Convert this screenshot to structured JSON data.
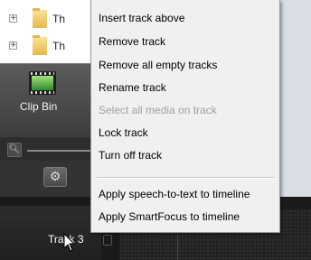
{
  "tree": {
    "items": [
      {
        "label": "Th",
        "expander": "+"
      },
      {
        "label": "Th",
        "expander": "+"
      }
    ]
  },
  "clip_bin": {
    "label": "Clip Bin"
  },
  "zoom": {
    "icon": "magnifier-icon"
  },
  "gear": {
    "icon": "gear-icon"
  },
  "track": {
    "label": "Track 3"
  },
  "context_menu": {
    "insert_track_above": "Insert track above",
    "remove_track": "Remove track",
    "remove_all_empty_tracks": "Remove all empty tracks",
    "rename_track": "Rename track",
    "select_all_media_on_track": "Select all media on track",
    "lock_track": "Lock track",
    "turn_off_track": "Turn off track",
    "apply_speech_to_text": "Apply speech-to-text to timeline",
    "apply_smartfocus": "Apply SmartFocus to timeline"
  },
  "colors": {
    "menu_bg": "#f0f0f0",
    "disabled_text": "#a0a0a0",
    "timeline_bg": "#1a1a1a"
  }
}
